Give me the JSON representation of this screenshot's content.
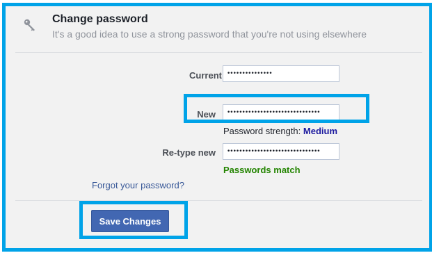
{
  "section": {
    "title": "Change password",
    "subtitle": "It's a good idea to use a strong password that you're not using elsewhere",
    "icon": "key-icon"
  },
  "fields": {
    "current": {
      "label": "Current",
      "masked_value": "•••••••••••••••"
    },
    "new": {
      "label": "New",
      "masked_value": "•••••••••••••••••••••••••••••••"
    },
    "retype": {
      "label": "Re-type new",
      "masked_value": "•••••••••••••••••••••••••••••••"
    }
  },
  "strength": {
    "prefix": "Password strength:",
    "level": "Medium"
  },
  "match_status": "Passwords match",
  "forgot_link": "Forgot your password?",
  "save_button": "Save Changes",
  "colors": {
    "highlight": "#00a3e8",
    "button": "#4267b2",
    "link": "#385898",
    "strength_level": "#1c1a9f",
    "match": "#238400"
  }
}
